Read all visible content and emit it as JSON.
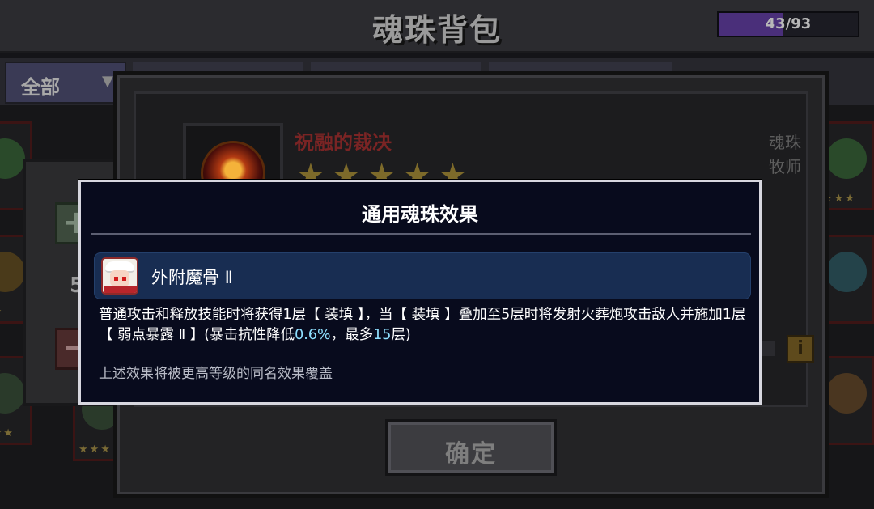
{
  "header": {
    "title": "魂珠背包",
    "capacity_text": "43/93",
    "capacity_fraction": 0.46,
    "capacity_color": "#4a2f7a"
  },
  "filter": {
    "selected": "全部",
    "arrow_icon": "triangle-down-icon"
  },
  "side_panel": {
    "count_text": "5",
    "plus_icon": "plus-icon",
    "minus_icon": "minus-icon"
  },
  "detail": {
    "item_name": "祝融的裁决",
    "stars": "★★★★★",
    "type_label": "魂珠",
    "class_label": "牧师",
    "info_icon": "info-icon",
    "confirm_label": "确定"
  },
  "modal": {
    "title": "通用魂珠效果",
    "effect_name": "外附魔骨 Ⅱ",
    "desc_part1": "普通攻击和释放技能时将获得1层【 装填 】，当【 装填 】叠加至5层时将发射火葬炮攻击敌人并施加1层【 弱点暴露 Ⅱ 】(暴击抗性降低",
    "desc_value1": "0.6%",
    "desc_part2": "，最多",
    "desc_value2": "15",
    "desc_part3": "层)",
    "note": "上述效果将被更高等级的同名效果覆盖",
    "highlight_color": "#8fe0ff"
  }
}
